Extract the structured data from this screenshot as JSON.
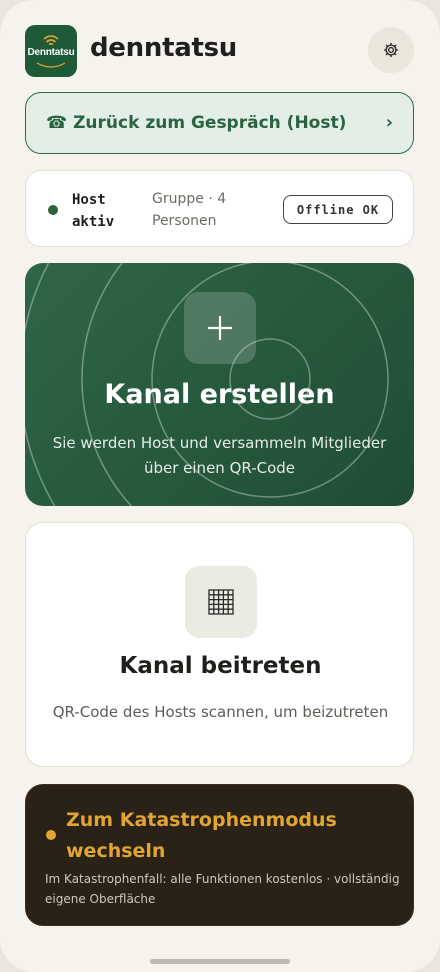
{
  "app": {
    "title": "denntatsu",
    "logo_text": "Denntatsu"
  },
  "return_banner": {
    "icon": "☎",
    "label": "Zurück zum Gespräch (Host)",
    "chevron": "›"
  },
  "status": {
    "host_label": "Host aktiv",
    "group_label": "Gruppe · 4 Personen",
    "badge": "Offline OK"
  },
  "create": {
    "title": "Kanal erstellen",
    "description": "Sie werden Host und versammeln Mitglieder über einen QR-Code"
  },
  "join": {
    "title": "Kanal beitreten",
    "description": "QR-Code des Hosts scannen, um beizutreten"
  },
  "disaster": {
    "title": "Zum Katastrophenmodus wechseln",
    "description": "Im Katastrophenfall: alle Funktionen kostenlos · vollständig eigene Oberfläche"
  },
  "colors": {
    "brand_green": "#2a6340",
    "amber": "#e0a532",
    "dark_brown": "#2a2117"
  },
  "icons": [
    "settings-icon",
    "phone-icon",
    "chevron-right-icon",
    "plus-icon",
    "qr-grid-icon"
  ]
}
